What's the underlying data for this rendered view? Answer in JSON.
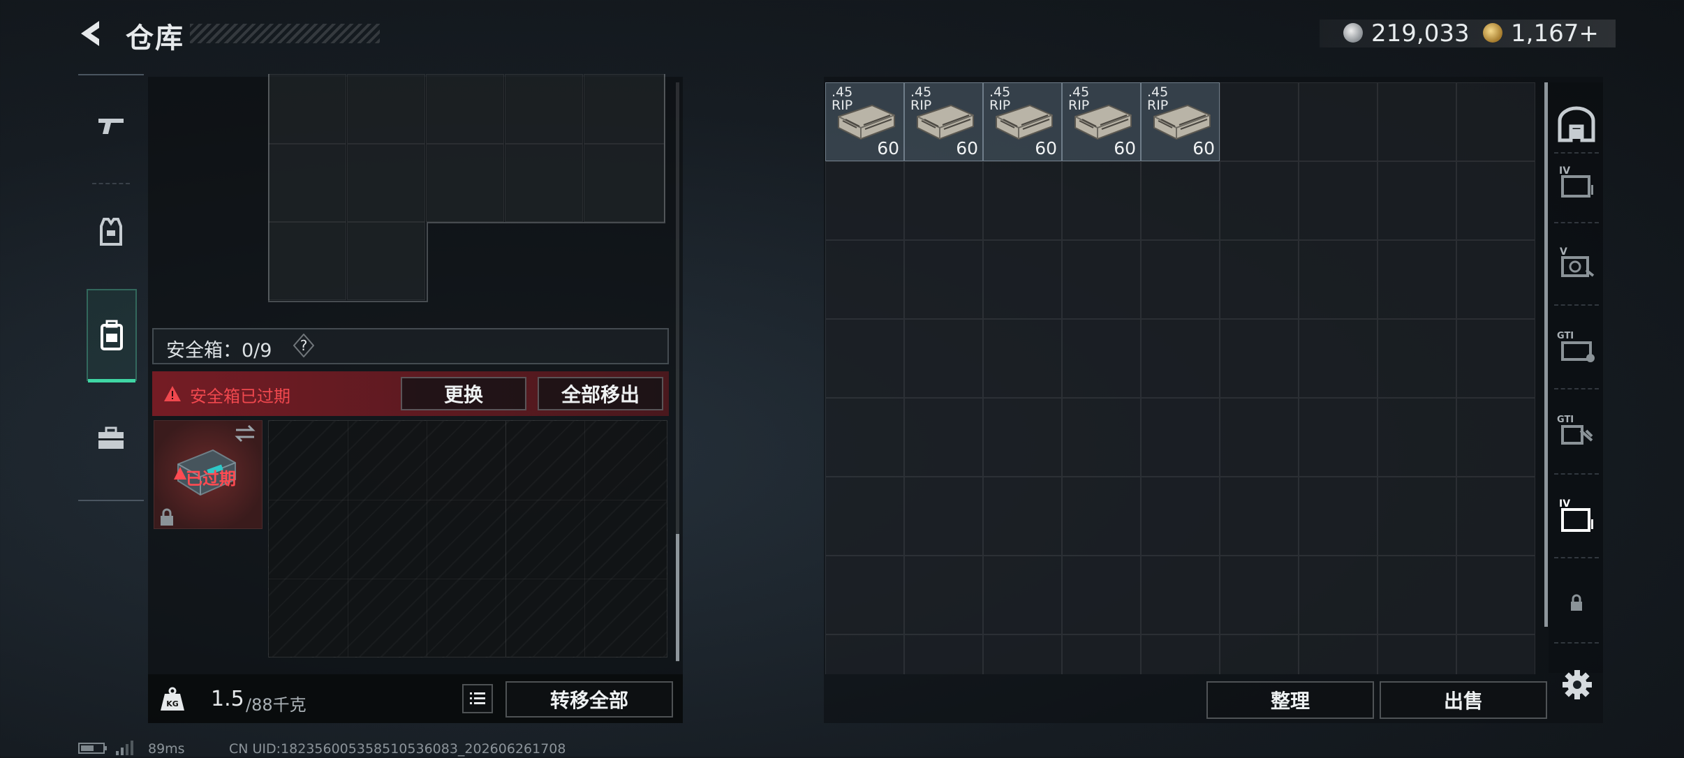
{
  "header": {
    "title": "仓库",
    "currency": [
      {
        "icon": "silver-coin-icon",
        "value": "219,033"
      },
      {
        "icon": "gold-coin-icon",
        "value": "1,167+"
      }
    ]
  },
  "left_sidebar": {
    "items": [
      {
        "icon": "gun-icon",
        "active": false
      },
      {
        "icon": "armor-vest-icon",
        "active": false
      },
      {
        "icon": "backpack-icon",
        "active": true
      },
      {
        "icon": "toolbox-icon",
        "active": false
      }
    ]
  },
  "safebox": {
    "label": "安全箱：0/9",
    "expired_notice": "安全箱已过期",
    "replace_label": "更换",
    "remove_all_label": "全部移出",
    "item_status": "已过期"
  },
  "weight": {
    "current": "1.5",
    "max": "/88千克"
  },
  "left_actions": {
    "transfer_all_label": "转移全部"
  },
  "storage_items": [
    {
      "caliber": ".45",
      "name_fragment": "RIP",
      "quantity": "60"
    },
    {
      "caliber": ".45",
      "name_fragment": "RIP",
      "quantity": "60"
    },
    {
      "caliber": ".45",
      "name_fragment": "RIP",
      "quantity": "60"
    },
    {
      "caliber": ".45",
      "name_fragment": "RIP",
      "quantity": "60"
    },
    {
      "caliber": ".45",
      "name_fragment": "RIP",
      "quantity": "60"
    }
  ],
  "right_actions": {
    "sort_label": "整理",
    "sell_label": "出售"
  },
  "right_tabs": [
    {
      "icon": "storage-overview-icon"
    },
    {
      "icon": "storage-iv-icon",
      "text": "IV"
    },
    {
      "icon": "storage-v-icon",
      "text": "V"
    },
    {
      "icon": "storage-gti-icon",
      "text": "GTI"
    },
    {
      "icon": "storage-gti-2-icon",
      "text": "GTI"
    },
    {
      "icon": "storage-iv-selected-icon",
      "text": "IV"
    },
    {
      "icon": "lock-icon"
    }
  ],
  "footer": {
    "ping": "89ms",
    "uid": "CN UID:18235600535851053608​3_202606261708"
  },
  "colors": {
    "accent_green": "#3fd6a4",
    "warning_red": "#f0484e",
    "item_bg": "#566674"
  }
}
